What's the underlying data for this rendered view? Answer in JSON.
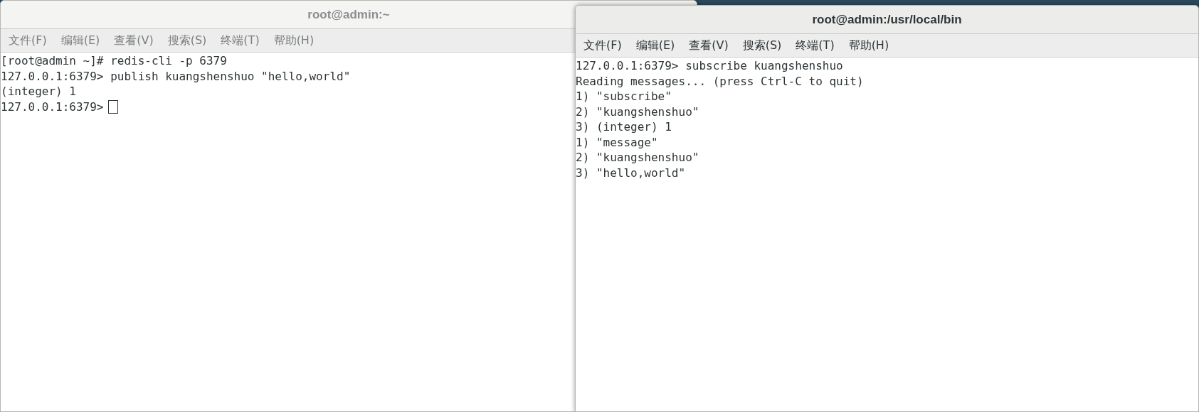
{
  "windows": [
    {
      "title": "root@admin:~",
      "active": false,
      "cursor": true,
      "menu": [
        "文件(F)",
        "编辑(E)",
        "查看(V)",
        "搜索(S)",
        "终端(T)",
        "帮助(H)"
      ],
      "lines": [
        "[root@admin ~]# redis-cli -p 6379",
        "127.0.0.1:6379> publish kuangshenshuo \"hello,world\"",
        "(integer) 1",
        "127.0.0.1:6379>"
      ]
    },
    {
      "title": "root@admin:/usr/local/bin",
      "active": true,
      "cursor": false,
      "menu": [
        "文件(F)",
        "编辑(E)",
        "查看(V)",
        "搜索(S)",
        "终端(T)",
        "帮助(H)"
      ],
      "lines": [
        "127.0.0.1:6379> subscribe kuangshenshuo",
        "Reading messages... (press Ctrl-C to quit)",
        "1) \"subscribe\"",
        "2) \"kuangshenshuo\"",
        "3) (integer) 1",
        "1) \"message\"",
        "2) \"kuangshenshuo\"",
        "3) \"hello,world\""
      ]
    }
  ]
}
